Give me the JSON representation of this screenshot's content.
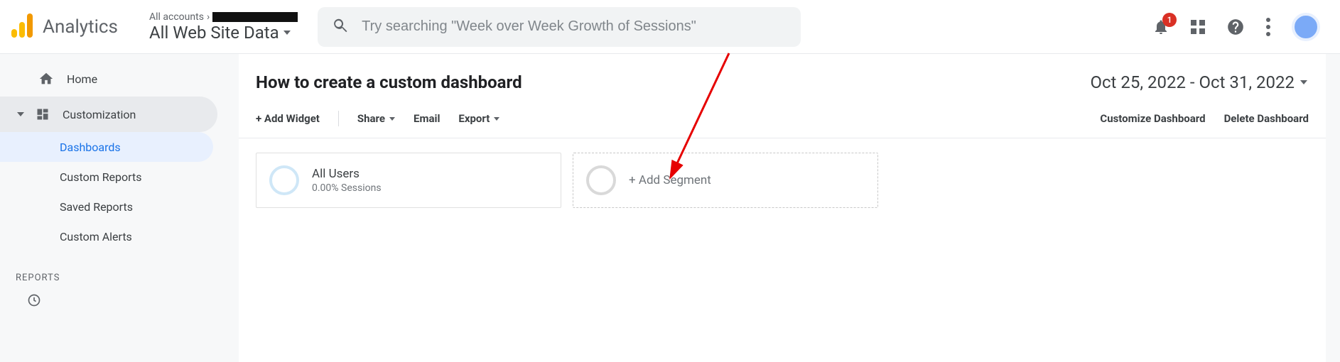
{
  "header": {
    "brand": "Analytics",
    "breadcrumb_label": "All accounts",
    "view_name": "All Web Site Data",
    "search_placeholder": "Try searching \"Week over Week Growth of Sessions\"",
    "notif_count": "1"
  },
  "sidebar": {
    "home": "Home",
    "customization": {
      "label": "Customization"
    },
    "subitems": [
      "Dashboards",
      "Custom Reports",
      "Saved Reports",
      "Custom Alerts"
    ],
    "reports_header": "REPORTS"
  },
  "panel": {
    "title": "How to create a custom dashboard",
    "date_range": "Oct 25, 2022 - Oct 31, 2022",
    "add_widget": "+ Add Widget",
    "share": "Share",
    "email": "Email",
    "export": "Export",
    "customize": "Customize Dashboard",
    "delete": "Delete Dashboard"
  },
  "segments": {
    "all_users": {
      "title": "All Users",
      "subtitle": "0.00% Sessions"
    },
    "add": "+ Add Segment"
  }
}
